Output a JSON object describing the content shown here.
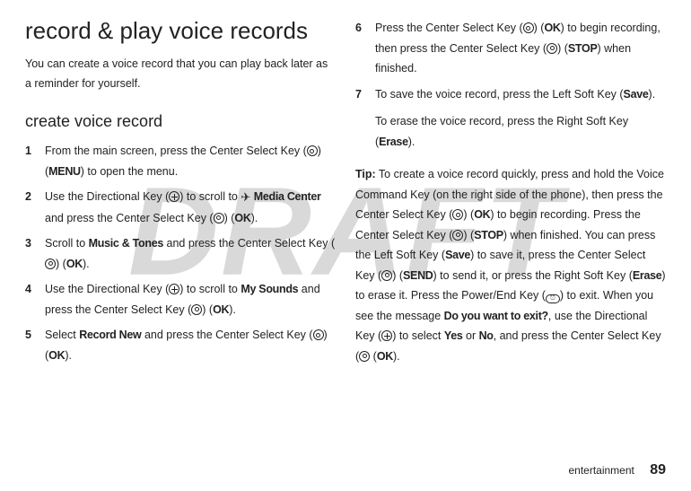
{
  "watermark": "DRAFT",
  "left": {
    "h1": "record & play voice records",
    "intro": "You can create a voice record that you can play back later as a reminder for yourself.",
    "h2": "create voice record",
    "step1_a": "From the main screen, press the Center Select Key (",
    "step1_b": ") (",
    "step1_menu": "MENU",
    "step1_c": ") to open the menu.",
    "step2_a": "Use the Directional Key (",
    "step2_b": ") to scroll to ",
    "step2_media": "Media Center",
    "step2_c": " and press the Center Select Key (",
    "step2_d": ") (",
    "step2_ok": "OK",
    "step2_e": ").",
    "step3_a": "Scroll to ",
    "step3_mt": "Music & Tones",
    "step3_b": " and press the Center Select Key (",
    "step3_c": ") (",
    "step3_ok": "OK",
    "step3_d": ").",
    "step4_a": "Use the Directional Key (",
    "step4_b": ") to scroll to ",
    "step4_ms": "My Sounds",
    "step4_c": " and press the Center Select Key (",
    "step4_d": ") (",
    "step4_ok": "OK",
    "step4_e": ").",
    "step5_a": "Select ",
    "step5_rn": "Record New",
    "step5_b": " and press the Center Select Key (",
    "step5_c": ") (",
    "step5_ok": "OK",
    "step5_d": ")."
  },
  "right": {
    "step6_a": "Press the Center Select Key (",
    "step6_b": ") (",
    "step6_ok": "OK",
    "step6_c": ") to begin recording, then press the Center Select Key (",
    "step6_d": ") (",
    "step6_stop": "STOP",
    "step6_e": ") when finished.",
    "step7_a": "To save the voice record, press the Left Soft Key (",
    "step7_save": "Save",
    "step7_b": ").",
    "erase_a": "To erase the voice record, press the Right Soft Key (",
    "erase_lbl": "Erase",
    "erase_b": ").",
    "tip_label": "Tip:",
    "tip_a": " To create a voice record quickly, press and hold the Voice Command Key (on the right side of the phone), then press the Center Select Key (",
    "tip_b": ") (",
    "tip_ok": "OK",
    "tip_c": ") to begin recording. Press the Center Select Key (",
    "tip_d": ") (",
    "tip_stop": "STOP",
    "tip_e": ") when finished. You can press the Left Soft Key (",
    "tip_save": "Save",
    "tip_f": ") to save it, press the Center Select Key (",
    "tip_g": ") (",
    "tip_send": "SEND",
    "tip_h": ") to send it, or press the Right Soft Key (",
    "tip_erase": "Erase",
    "tip_i": ") to erase it. Press the Power/End Key (",
    "tip_j": ") to exit. When you see the message ",
    "tip_exit": "Do you want to exit?",
    "tip_k": ", use the Directional Key (",
    "tip_l": ") to select ",
    "tip_yes": "Yes",
    "tip_m": " or ",
    "tip_no": "No",
    "tip_n": ", and press the Center Select Key (",
    "tip_o": " (",
    "tip_ok2": "OK",
    "tip_p": ")."
  },
  "footer": {
    "section": "entertainment",
    "page": "89"
  },
  "nums": {
    "n1": "1",
    "n2": "2",
    "n3": "3",
    "n4": "4",
    "n5": "5",
    "n6": "6",
    "n7": "7"
  }
}
